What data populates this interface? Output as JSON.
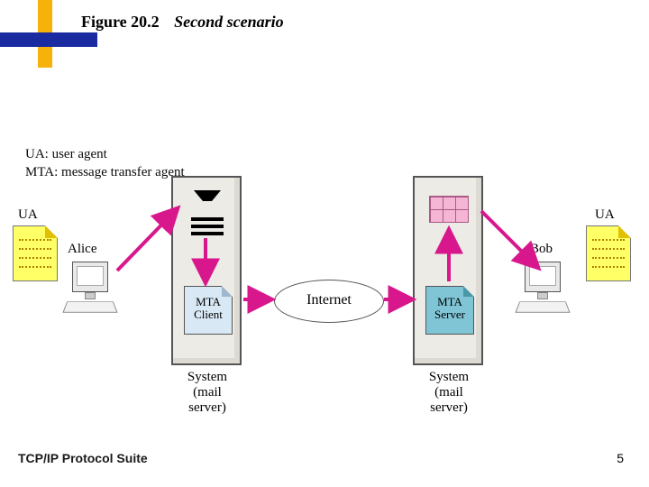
{
  "header": {
    "figure_number": "Figure 20.2",
    "figure_title": "Second scenario"
  },
  "legend": {
    "line1": "UA: user agent",
    "line2": "MTA: message transfer agent"
  },
  "diagram": {
    "ua_left_label": "UA",
    "ua_right_label": "UA",
    "alice": "Alice",
    "bob": "Bob",
    "mta_client": "MTA\nClient",
    "mta_server": "MTA\nServer",
    "internet": "Internet",
    "system_label": "System\n(mail server)"
  },
  "footer": {
    "left": "TCP/IP Protocol Suite",
    "page": "5"
  }
}
